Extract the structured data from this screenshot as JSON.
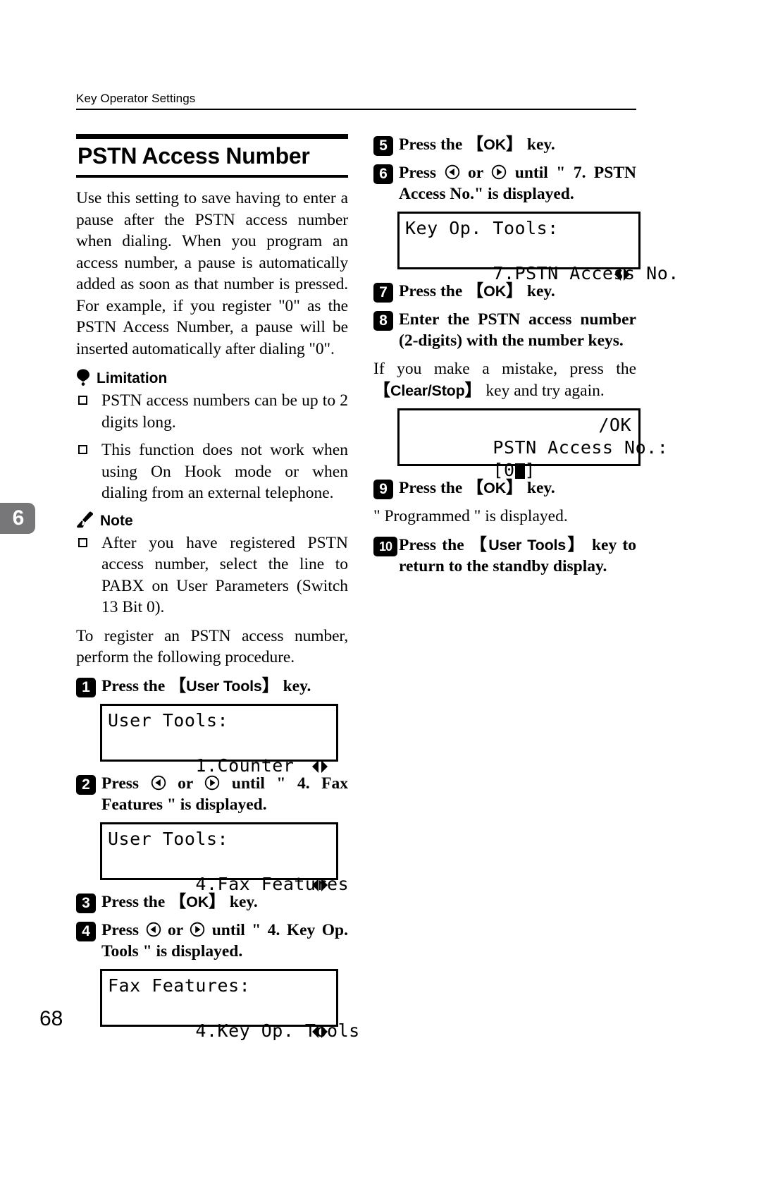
{
  "header": {
    "running_head": "Key Operator Settings"
  },
  "chapter_tab": {
    "number": "6"
  },
  "folio": {
    "page_number": "68"
  },
  "section": {
    "title": "PSTN Access Number"
  },
  "left_column": {
    "intro": "Use this setting to save having to enter a pause after the PSTN access number when dialing. When you program an access number, a pause is automatically added as soon as that number is pressed. For example, if you register \"0\" as the PSTN Access Number, a pause will be inserted automatically after dialing \"0\".",
    "limitation": {
      "heading": "Limitation",
      "icon": "balloon-icon",
      "items": [
        "PSTN access numbers can be up to 2 digits long.",
        "This function does not work when using On Hook mode or when dialing from an external telephone."
      ]
    },
    "note": {
      "heading": "Note",
      "icon": "pencil-icon",
      "items": [
        "After you have registered PSTN access number, select the line to PABX on User Parameters (Switch 13 Bit 0)."
      ]
    },
    "procedure_intro": "To register an PSTN access number, perform the following procedure.",
    "steps": [
      {
        "number": "1",
        "text_before": "Press the ",
        "key": "User Tools",
        "text_after": " key."
      },
      {
        "number": "2",
        "text_before": "Press ",
        "arrow_left": "left-arrow-key-icon",
        "text_mid": " or ",
        "arrow_right": "right-arrow-key-icon",
        "text_after": " until \" 4. Fax Features \" is displayed."
      },
      {
        "number": "3",
        "text_before": "Press the ",
        "key": "OK",
        "text_after": " key."
      },
      {
        "number": "4",
        "text_before": "Press ",
        "arrow_left": "left-arrow-key-icon",
        "text_mid": " or ",
        "arrow_right": "right-arrow-key-icon",
        "text_after": " until \" 4. Key Op. Tools \" is displayed."
      }
    ],
    "lcd_1": {
      "line1": "User Tools:",
      "line2": "1.Counter",
      "arrows": "left-right-arrows-icon"
    },
    "lcd_2": {
      "line1": "User Tools:",
      "line2": "4.Fax Features",
      "arrows": "left-right-arrows-icon"
    },
    "lcd_3": {
      "line1": "Fax Features:",
      "line2": "4.Key Op. Tools",
      "arrows": "left-right-arrows-icon"
    }
  },
  "right_column": {
    "steps": [
      {
        "number": "5",
        "text_before": "Press the ",
        "key": "OK",
        "text_after": " key."
      },
      {
        "number": "6",
        "text_before": "Press ",
        "arrow_left": "left-arrow-key-icon",
        "text_mid": " or ",
        "arrow_right": "right-arrow-key-icon",
        "text_after": " until \" 7. PSTN Access No.\" is displayed."
      },
      {
        "number": "7",
        "text_before": "Press the ",
        "key": "OK",
        "text_after": " key."
      },
      {
        "number": "8",
        "text_full": "Enter the PSTN access number (2-digits) with the number keys.",
        "sub_before": "If you make a mistake, press the ",
        "sub_key": "Clear/Stop",
        "sub_after": " key and try again."
      },
      {
        "number": "9",
        "text_before": "Press the ",
        "key": "OK",
        "text_after": " key.",
        "sub_plain": "\" Programmed \" is displayed."
      },
      {
        "number": "10",
        "text_before": "Press the ",
        "key": "User Tools",
        "text_after": " key to return to the standby display."
      }
    ],
    "lcd_4": {
      "line1": "Key Op. Tools:",
      "line2": "7.PSTN Access No.",
      "arrows": "left-right-arrows-icon"
    },
    "lcd_5": {
      "line1": "PSTN Access No.:",
      "line1_tail": "/OK",
      "line2": "[0",
      "line2_cursor": "block-cursor",
      "line2_end": "]"
    }
  }
}
